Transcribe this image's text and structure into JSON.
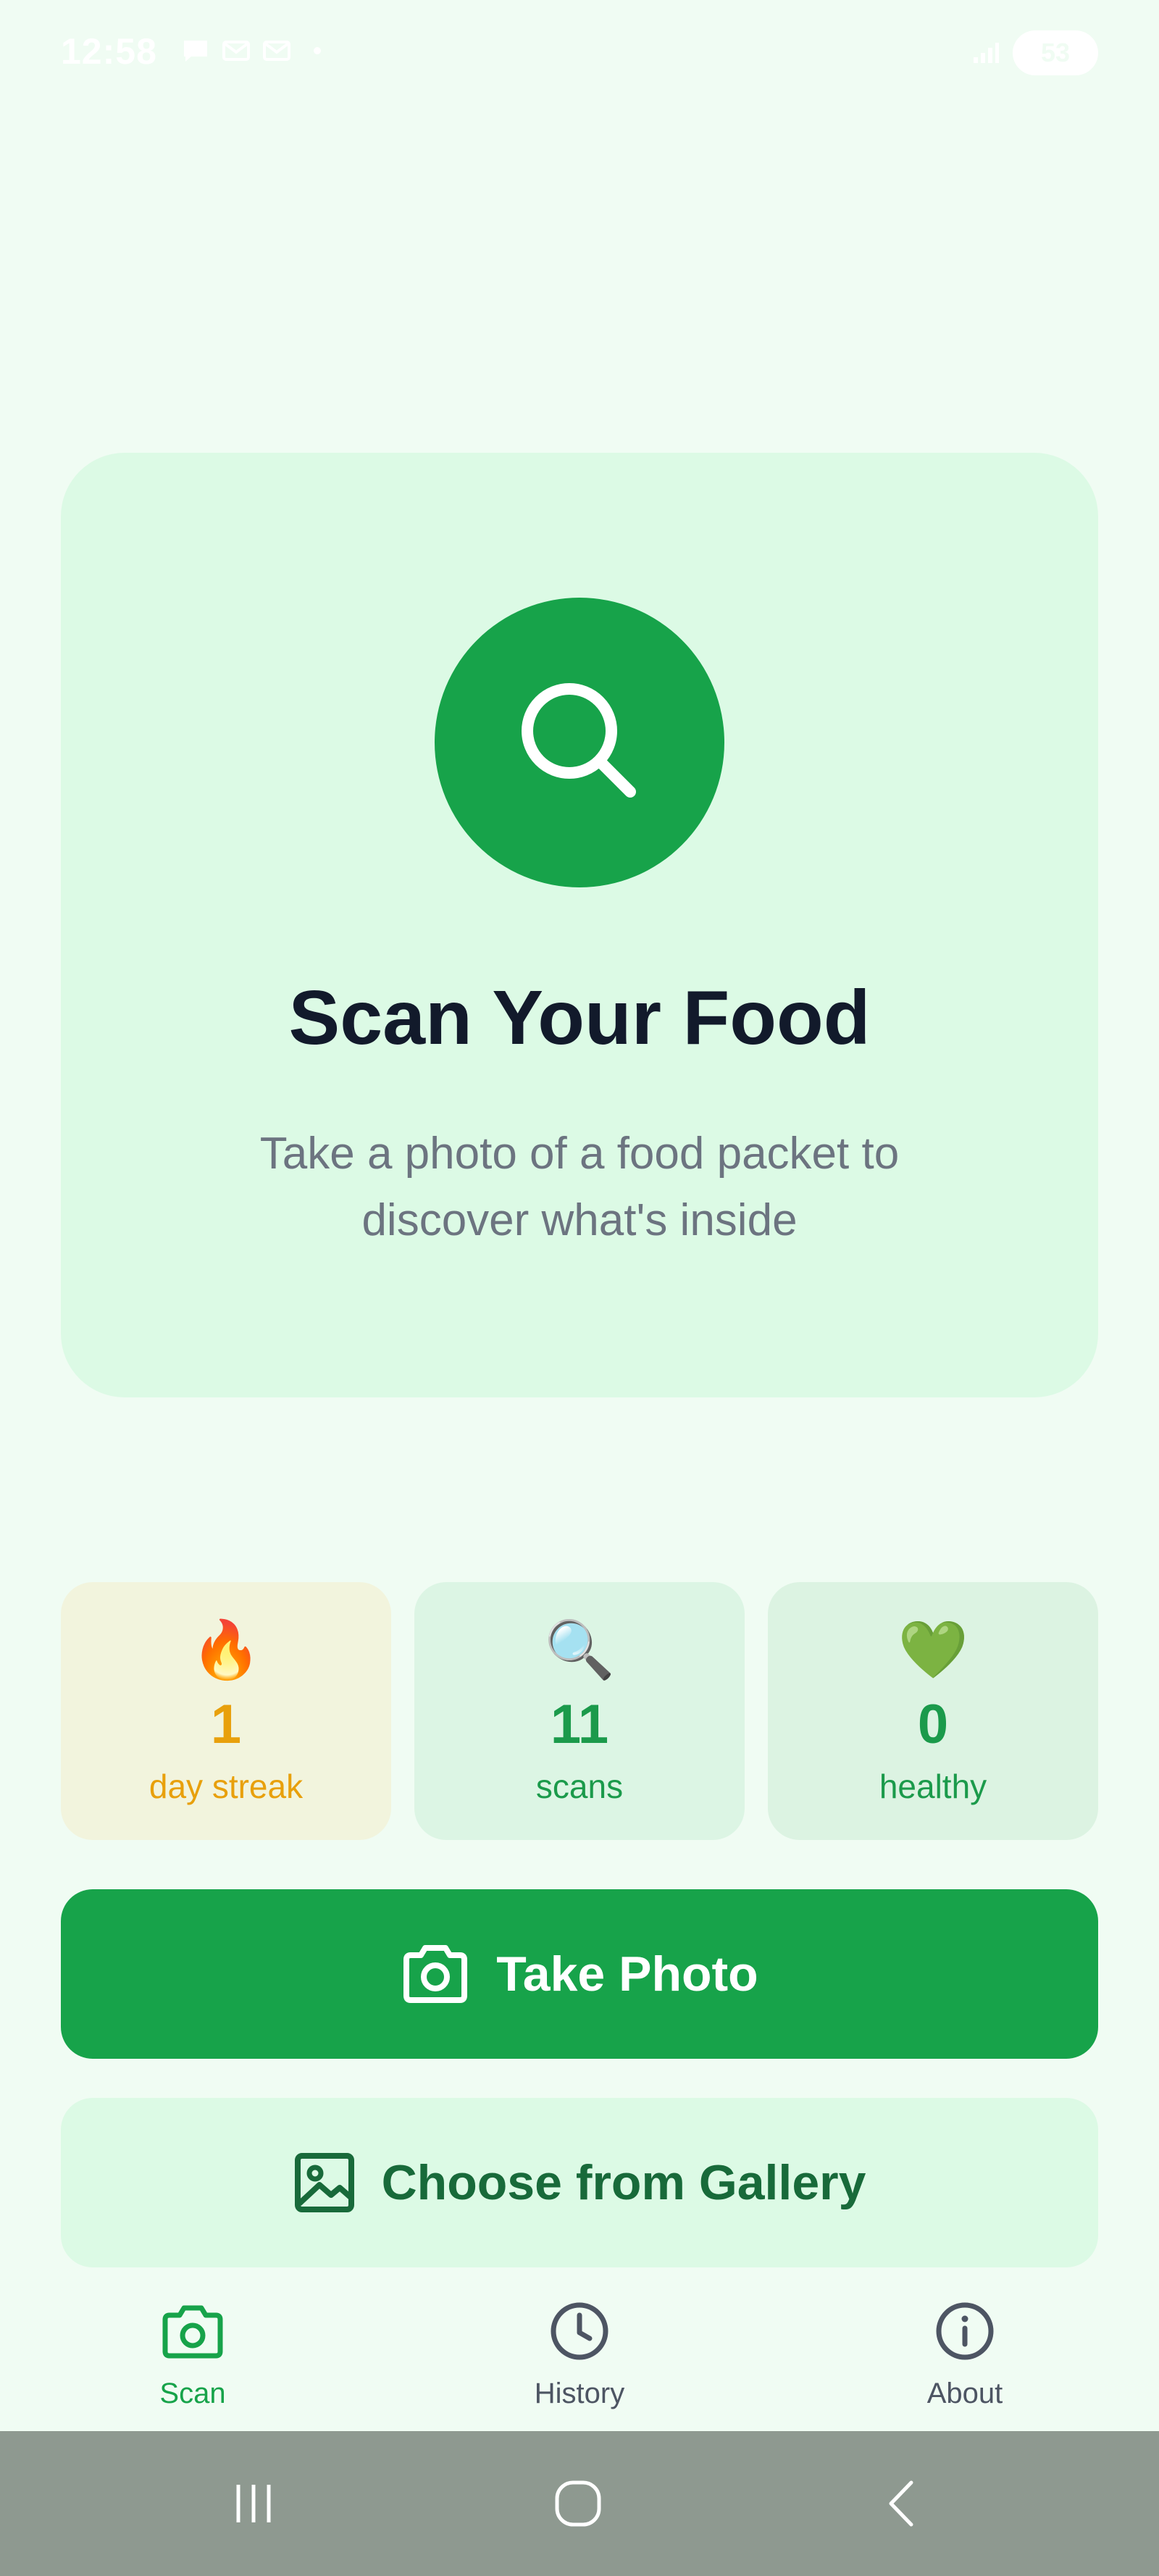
{
  "status_bar": {
    "time": "12:58",
    "battery": "53"
  },
  "hero": {
    "title": "Scan Your Food",
    "subtitle": "Take a photo of a food packet to discover what's inside",
    "icon": "search-icon",
    "accent_color": "#17a34a"
  },
  "stats": [
    {
      "emoji": "🔥",
      "value": "1",
      "label": "day streak",
      "color": "#e8a00c"
    },
    {
      "emoji": "🔍",
      "value": "11",
      "label": "scans",
      "color": "#1b9a4b"
    },
    {
      "emoji": "💚",
      "value": "0",
      "label": "healthy",
      "color": "#1b9a4b"
    }
  ],
  "actions": {
    "take_photo": "Take Photo",
    "choose_gallery": "Choose from Gallery"
  },
  "nav": {
    "items": [
      {
        "label": "Scan",
        "icon": "camera-icon",
        "active": true
      },
      {
        "label": "History",
        "icon": "clock-icon",
        "active": false
      },
      {
        "label": "About",
        "icon": "info-icon",
        "active": false
      }
    ]
  },
  "colors": {
    "background": "#f0fcf3",
    "card": "#dcfae5",
    "primary": "#17a34a",
    "text_dark": "#121a2b",
    "text_muted": "#6c7480"
  }
}
